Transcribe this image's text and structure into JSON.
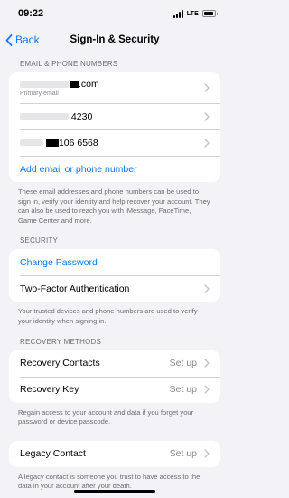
{
  "status": {
    "time": "09:22",
    "network": "LTE"
  },
  "nav": {
    "back_label": "Back",
    "title": "Sign-In & Security"
  },
  "email_section": {
    "header": "EMAIL & PHONE NUMBERS",
    "email_suffix": ".com",
    "email_caption": "Primary email",
    "phone1_suffix": "4230",
    "phone2_suffix": "106 6568",
    "add_label": "Add email or phone number",
    "footer": "These email addresses and phone numbers can be used to sign in, verify your identity and help recover your account. They can also be used to reach you with iMessage, FaceTime, Game Center and more."
  },
  "security_section": {
    "header": "SECURITY",
    "change_password": "Change Password",
    "two_factor": "Two-Factor Authentication",
    "footer": "Your trusted devices and phone numbers are used to verify your identity when signing in."
  },
  "recovery_section": {
    "header": "RECOVERY METHODS",
    "contacts_label": "Recovery Contacts",
    "contacts_value": "Set up",
    "key_label": "Recovery Key",
    "key_value": "Set up",
    "footer": "Regain access to your account and data if you forget your password or device passcode."
  },
  "legacy_section": {
    "label": "Legacy Contact",
    "value": "Set up",
    "footer": "A legacy contact is someone you trust to have access to the data in your account after your death."
  },
  "colors": {
    "accent": "#0a7aff",
    "background": "#f2f2f7"
  }
}
